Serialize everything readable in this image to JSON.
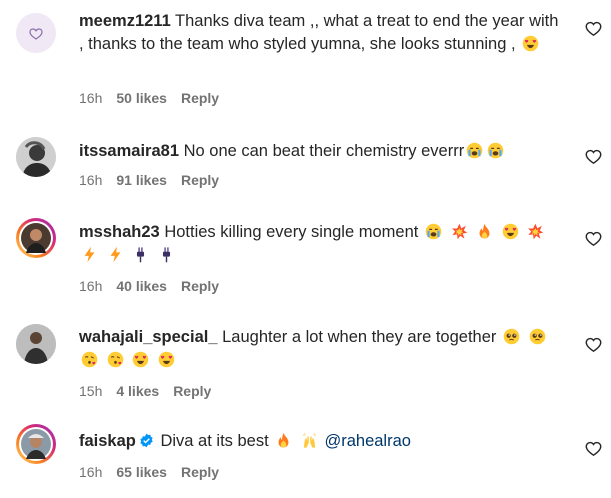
{
  "comments": [
    {
      "username": "meemz1211",
      "text": "Thanks diva team ,, what a treat to end the year with , thanks to the team who styled yumna, she looks stunning ,",
      "emojis": [
        "heart-eyes-emoji"
      ],
      "time": "16h",
      "likes": "50 likes",
      "reply": "Reply"
    },
    {
      "username": "itssamaira81",
      "text": "No one can beat their chemistry everrr",
      "emojis": [
        "crying-emoji",
        "crying-emoji"
      ],
      "time": "16h",
      "likes": "91 likes",
      "reply": "Reply"
    },
    {
      "username": "msshah23",
      "text": "Hotties killing every single moment",
      "emojis": [
        "crying-emoji",
        "collision-emoji",
        "fire-emoji",
        "heart-eyes-emoji",
        "collision-emoji",
        "lightning-emoji",
        "lightning-emoji",
        "plug-emoji",
        "plug-emoji"
      ],
      "time": "16h",
      "likes": "40 likes",
      "reply": "Reply"
    },
    {
      "username": "wahajali_special_",
      "text": "Laughter a lot when they are together",
      "emojis": [
        "pleading-emoji",
        "pleading-emoji",
        "kissing-heart-emoji",
        "kissing-heart-emoji",
        "heart-eyes-emoji",
        "heart-eyes-emoji"
      ],
      "time": "15h",
      "likes": "4 likes",
      "reply": "Reply"
    },
    {
      "username": "faiskap",
      "verified": true,
      "text": "Diva at its best",
      "emojis": [
        "fire-emoji",
        "raised-hands-emoji"
      ],
      "mention": "@rahealrao",
      "time": "16h",
      "likes": "65 likes",
      "reply": "Reply"
    }
  ],
  "icons": {
    "like": "heart-outline-icon",
    "verified": "verified-badge-icon"
  },
  "colors": {
    "text": "#262626",
    "meta": "#737373",
    "mention": "#00376b",
    "verified": "#0095f6"
  }
}
